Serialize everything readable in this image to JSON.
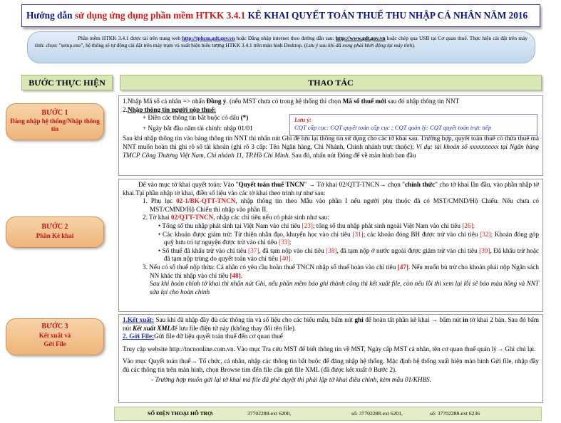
{
  "title": {
    "part1": "Hướng dẫn ",
    "part2": "sử dụng ứng dụng phần mềm HTKK 3.4.1",
    "part3": " KÊ KHAI QUYẾT TOÁN THUẾ THU NHẬP CÁ NHÂN NĂM 2016"
  },
  "intro": {
    "t1": "Phần mềm HTKK 3.4.1 được tải trên trang web ",
    "link1": "http://tphcm.gdt.gov.vn",
    "t2": " hoặc   Đăng nhập internet theo đường dẫn sau: ",
    "link2": "http://www.gdt.gov.vn",
    "t3": " hoặc chép qua USB tại Cơ quan thuế. Thực hiện cài đặt trên máy tính: chọn: \"setup.exe\", hệ thống sẽ tự động cài đặt trên máy trạm và xuất hiện biểu tượng HTKK 3.4.1   trên màn hình Desktop. (",
    "t4": "Lưu ý sau khi đã xong phải khởi động lại máy tính",
    "t5": ")."
  },
  "headers": {
    "left": "BƯỚC THỰC HIỆN",
    "right": "THAO TÁC"
  },
  "steps": [
    {
      "title": "BƯỚC 1",
      "sub": "Đăng nhập hệ thống/Nhập thông tin"
    },
    {
      "title": "BƯỚC 2",
      "sub": "Phần Kê khai"
    },
    {
      "title": "BƯỚC 3",
      "sub": "Kết xuất và Gởi File"
    }
  ],
  "step1": {
    "l1a": "1.Nhập Mã số cá nhân => nhấn ",
    "l1b": "Đồng ý",
    "l1c": ". (nếu MST chưa có trong hệ thống thì chọn ",
    "l1d": "Mã số thuế mới",
    "l1e": " sau đó nhập thông tin NNT",
    "l2a": "2.",
    "l2b": "Nhập thông tin người nộp thuế:",
    "b1": "+ Điền các thông tin bắt buộc có dấu ",
    "b1s": "(*)",
    "b2": "+ Ngày bắt đầu năm tài chính: nhập 01/01",
    "note_title": "Lưu ý:",
    "note_text": "CQT cấp cục: CQT quyết toán cấp cục ; CQT quản lý: CQT quyết toán trực tiếp",
    "p3": "Sau khi nhập thông tin vào bảng thông tin NNT thì nhấn nút Ghi để lưu lại thông tin sử dụng cho các tờ khai sau.  Trường hợp, quyết toán thuế có thừa thuế mà NNT muốn hoàn thì ghi rõ số tài khoản (ghi rõ 3 cấp: Tên Ngân hàng, Chi Nhánh, Chinh nhánh trực thuộc); ",
    "p3i": "Ví dụ: tài khoản số xxxxxxxxxx tại Ngân hàng TMCP Công Thương Việt Nam, Chi nhánh 11, TP.Hồ Chí Minh",
    "p3e": ". Sau đó, nhấn nút Đóng để về màn hình ban đầu"
  },
  "step2": {
    "p1a": "Để vào mục tờ khai quyết toán: Vào \"",
    "p1b": "Quyết toán thuế TNCN",
    "p1c": "\" → Tờ khai 02/QTT-TNCN→ chọn \"",
    "p1d": "chính thức",
    "p1e": "\" cho tờ khai lần đầu, vào phần nhập tờ khai.Tại phần nhập tờ khai, điền số liệu vào các tờ khai theo trình tự như sau:",
    "i1a": "1.  Phụ lục ",
    "i1b": "02-1/BK-QTT-TNCN",
    "i1c": ", nhập thông tin theo Mẫu vào phần I nếu người phụ thuộc đã có MST/CMND/Hộ Chiếu. Nếu chưa có MST/CMND/Hộ Chiếu thì nhập vào phần II.",
    "i2a": "2.  Tờ khai ",
    "i2b": "02/QTT-TNCN",
    "i2c": ", nhập  các chỉ tiêu nếu có phát sinh như sau:",
    "a1a": "Tổng số thu nhập  phát sinh tại Việt Nam vào chỉ tiêu ",
    "a1b": "[23]",
    "a1c": "; tổng số thu nhập  phát sinh ngoài Việt Nam vào chỉ tiêu ",
    "a1d": "[26];",
    "a2a": "Các khoản được giảm trừ: Từ thiện nhân đạo, khuyến học vào chỉ tiêu ",
    "a2b": "[31]",
    "a2c": "; các khoản đóng BH được trừ vào chỉ tiêu ",
    "a2d": "[32];",
    "a2e": " Khoản đóng góp quỹ hưu trí tự nguyện được trừ vào chỉ tiêu ",
    "a2f": "[33];",
    "a3a": "Số thuế đã khấu trừ vào chỉ tiêu ",
    "a3b": "[37]",
    "a3c": ", đã tạm nộp vào chỉ tiêu ",
    "a3d": "[38]",
    "a3e": ", đã tạm nộp ở nước ngoài được giảm trừ vào chỉ tiêu ",
    "a3f": "[39]",
    "a3g": ", Đã khấu trừ hoặc đã tạm nộp trùng do quyết toán vào chỉ tiêu ",
    "a3h": "[40].",
    "i3a": "3.  Nếu có số thuế nộp thừa: Cá nhân có yêu cầu hoàn thuế TNCN nhập số thuế hoàn vào chỉ tiêu ",
    "i3b": "[47]",
    "i3c": ". Nếu muốn bù trừ cho khoản phải nộp Ngân sách NN khác thì nhập vào chỉ tiêu ",
    "i3d": "[48]",
    "i3e": ".",
    "p_end": "Sau khi hoàn chỉnh tờ khai thì nhấn nút Ghi, nếu phần mềm báo ghi thành công thì kết xuất file, còn nếu lỗi thì xem lại lỗi sẽ báo màu hồng và NNT sửa lại cho hoàn chỉnh"
  },
  "step3": {
    "h1": "1.Kết xuất:",
    "p1a": " Sau khi đã nhập đầy đủ các thông tin và số liệu cho các biểu mẫu, bấm nút ",
    "p1b": "ghi",
    "p1c": " để hoàn tất phần kê khai → bấm nút ",
    "p1d": "in",
    "p1e": " tờ khai 2 bản. Sau đó bấm nút ",
    "p1f": "Kết xuất XML",
    "p1g": "để lưu file điện tử này (không thay đổi tên file).",
    "h2": "2. Gởi File:",
    "p2": "Gửi file dữ liệu quyết toán thuế đến cơ quan thuế",
    "p3": "Truy cập website http://tncnonline.com.vn. Vào mục Tra cứu MST để biết thông tin về MST, Ngày cấp MST cá nhân, tên cơ quan thuế quản lý→ Ghi chú lại.",
    "p4": "Vào mục Quyết toán thuế→ Tổ chức, cá nhân, nhập các thông tin bắt buộc để đăng nhập hệ thống. Mặc định hệ thống xuất hiện màn hình Gửi file, nhập đầy đủ các thông tin trên màn hình, chọn Browse tìm đến file cần gửi file XML (đã được kết xuất ở Bước 2).",
    "p5": "-  Trường hợp muốn gửi lại tờ khai mà file đã phê duyệt thì phải lập tờ khai điều chỉnh, kèm mẫu 01/KHBS."
  },
  "footer": {
    "label": "SỐ ĐIỆN THOẠI HỖ TRỢ:",
    "n1": "37702288-ext 6200,",
    "n2": "số: 37702288-ext 6201,",
    "n3": "số: 37702288-ext 6236"
  }
}
